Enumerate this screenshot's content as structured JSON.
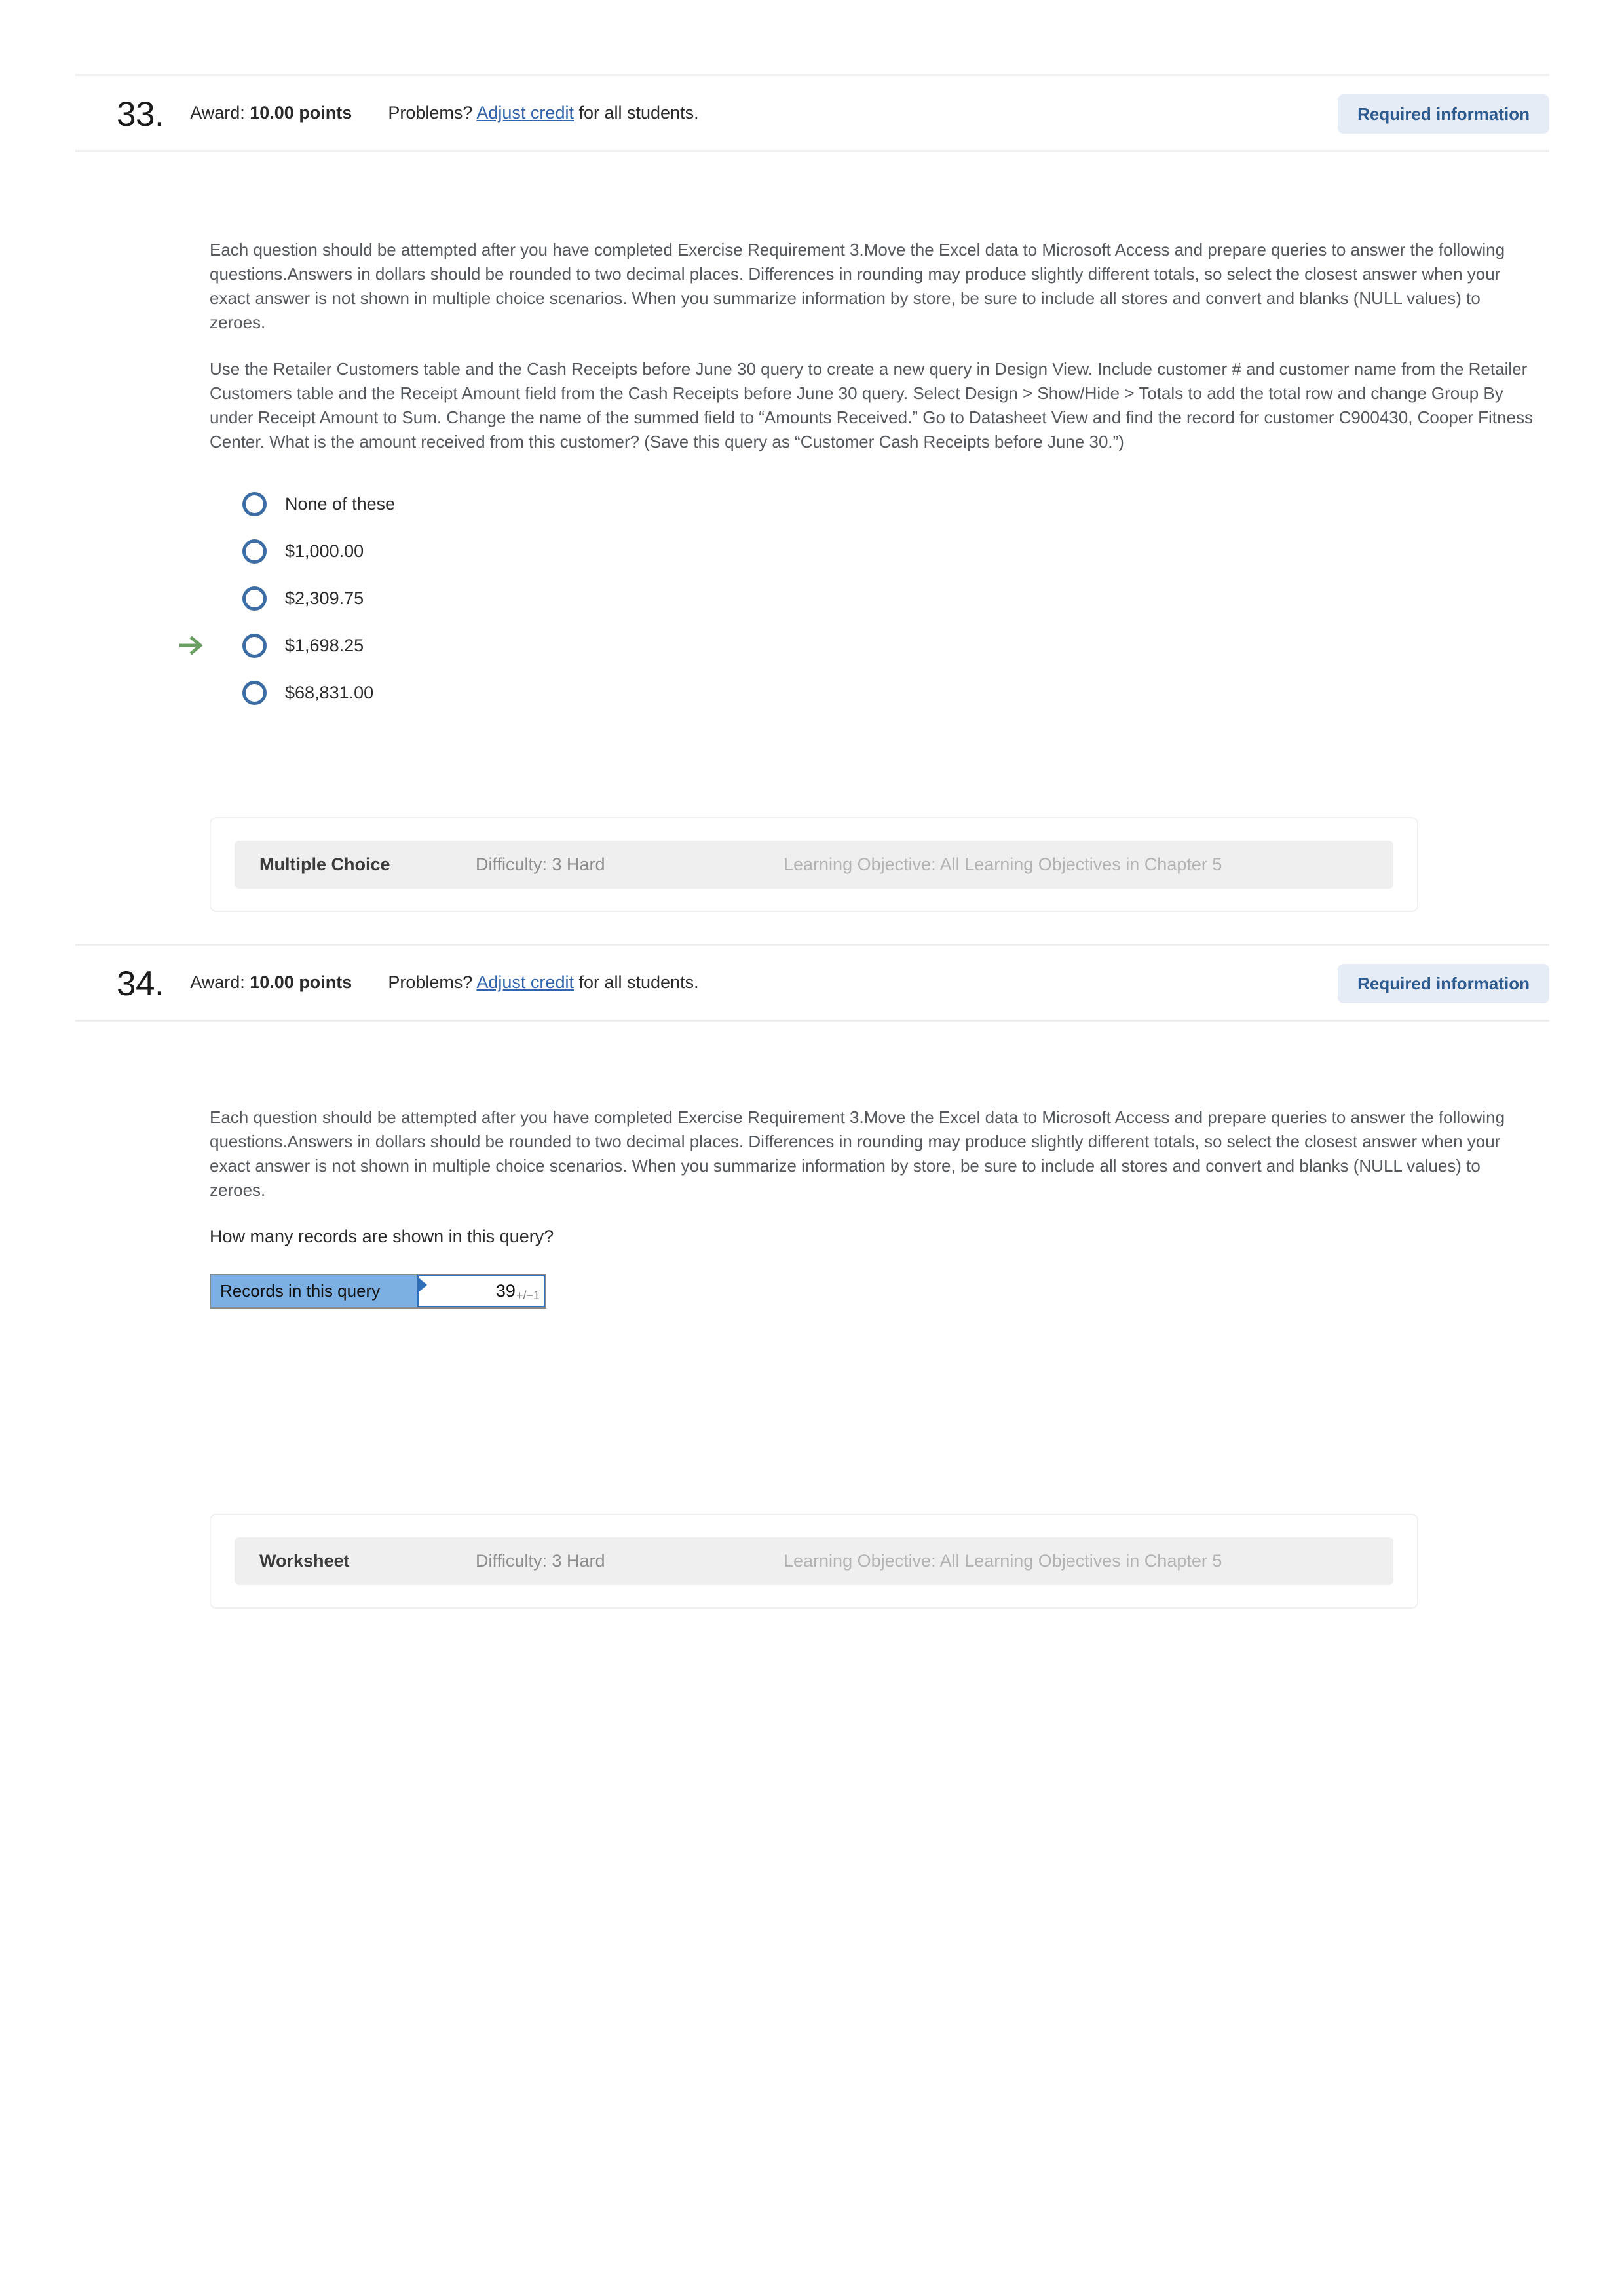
{
  "colors": {
    "link": "#2f63ad",
    "badge_bg": "#e6ecf5",
    "badge_text": "#2e5b8f",
    "radio": "#3c6da5",
    "arrow": "#6a9f62",
    "answer_label_bg": "#7cb0e3",
    "answer_border": "#2f6fba",
    "meta_bar_bg": "#efefef"
  },
  "questions": [
    {
      "number": "33.",
      "award_prefix": "Award:",
      "award_points": "10.00 points",
      "problems_prefix": "Problems?",
      "adjust_credit_link": "Adjust credit",
      "problems_suffix": "for all students.",
      "required_information_label": "Required information",
      "intro_paragraph": "Each question should be attempted after you have completed Exercise Requirement 3.Move the Excel data to Microsoft Access and prepare queries to answer the following questions.Answers in dollars should be rounded to two decimal places. Differences in rounding may produce slightly different totals, so select the closest answer when your exact answer is not shown in multiple choice scenarios. When you summarize information by store, be sure to include all stores and convert and blanks (NULL values) to zeroes.",
      "prompt_paragraph": "Use the Retailer Customers table and the Cash Receipts before June 30 query to create a new query in Design View. Include customer # and customer name from the Retailer Customers table and the Receipt Amount field from the Cash Receipts before June 30 query. Select Design > Show/Hide > Totals to add the total row and change Group By under Receipt Amount to Sum. Change the name of the summed field to “Amounts Received.” Go to Datasheet View and find the record for customer C900430, Cooper Fitness Center. What is the amount received from this customer? (Save this query as “Customer Cash Receipts before June 30.”)",
      "choices": [
        {
          "label": "None of these",
          "marked": false
        },
        {
          "label": "$1,000.00",
          "marked": false
        },
        {
          "label": "$2,309.75",
          "marked": false
        },
        {
          "label": "$1,698.25",
          "marked": true
        },
        {
          "label": "$68,831.00",
          "marked": false
        }
      ],
      "meta": {
        "type": "Multiple Choice",
        "difficulty": "Difficulty: 3 Hard",
        "objective": "Learning Objective: All Learning Objectives in Chapter 5"
      }
    },
    {
      "number": "34.",
      "award_prefix": "Award:",
      "award_points": "10.00 points",
      "problems_prefix": "Problems?",
      "adjust_credit_link": "Adjust credit",
      "problems_suffix": "for all students.",
      "required_information_label": "Required information",
      "intro_paragraph": "Each question should be attempted after you have completed Exercise Requirement 3.Move the Excel data to Microsoft Access and prepare queries to answer the following questions.Answers in dollars should be rounded to two decimal places. Differences in rounding may produce slightly different totals, so select the closest answer when your exact answer is not shown in multiple choice scenarios. When you summarize information by store, be sure to include all stores and convert and blanks (NULL values) to zeroes.",
      "prompt_paragraph": "How many records are shown in this query?",
      "answer_field": {
        "label": "Records in this query",
        "value": "39",
        "tolerance": "+/−1"
      },
      "meta": {
        "type": "Worksheet",
        "difficulty": "Difficulty: 3 Hard",
        "objective": "Learning Objective: All Learning Objectives in Chapter 5"
      }
    }
  ]
}
